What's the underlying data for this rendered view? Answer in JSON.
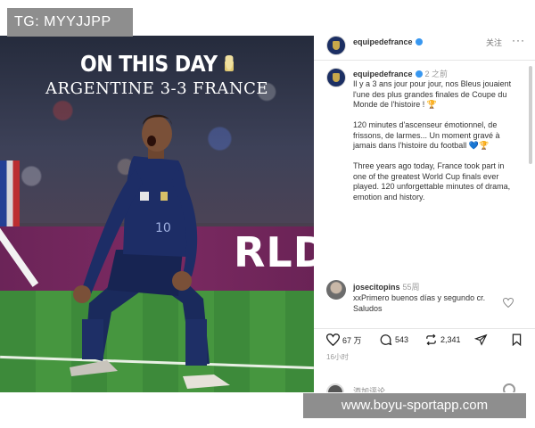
{
  "watermark": {
    "text": "TG: MYYJJPP"
  },
  "footer_watermark": {
    "text": "www.boyu-sportapp.com"
  },
  "photo": {
    "headline_line1": "ON THIS DAY",
    "headline_line2": "ARGENTINE 3-3 FRANCE",
    "board_text": "RLD'S T",
    "trophy_icon": "trophy-icon"
  },
  "header": {
    "account_name": "equipedefrance",
    "follow_label": "关注",
    "more_label": "···",
    "verified_icon": "verified-badge-icon"
  },
  "caption": {
    "account_name": "equipedefrance",
    "time": "2 之前",
    "text": "Il y a 3 ans jour pour jour, nos Bleus jouaient l'une des plus grandes finales de Coupe du Monde de l'histoire ! 🏆\n\n120 minutes d'ascenseur émotionnel, de frissons, de larmes... Un moment gravé à jamais dans l'histoire du football 💙🏆\n\nThree years ago today, France took part in one of the greatest World Cup finals ever played. 120 unforgettable minutes of drama, emotion and history."
  },
  "comment": {
    "author": "josecitopins",
    "time": "55周",
    "text": "xxPrimero buenos días y segundo cr. Saludos"
  },
  "actions": {
    "likes": "67 万",
    "comments": "543",
    "shares": "2,341",
    "like_icon": "heart-icon",
    "comment_icon": "comment-icon",
    "share_icon": "repost-icon",
    "send_icon": "send-icon",
    "save_icon": "bookmark-icon"
  },
  "post_date": "16小时",
  "next_post": {
    "name": "添加评论..."
  },
  "colors": {
    "france_navy": "#1c2f63",
    "board_magenta": "#7c2a62",
    "pitch_green": "#3d8a3a",
    "verified_blue": "#3897f0"
  }
}
